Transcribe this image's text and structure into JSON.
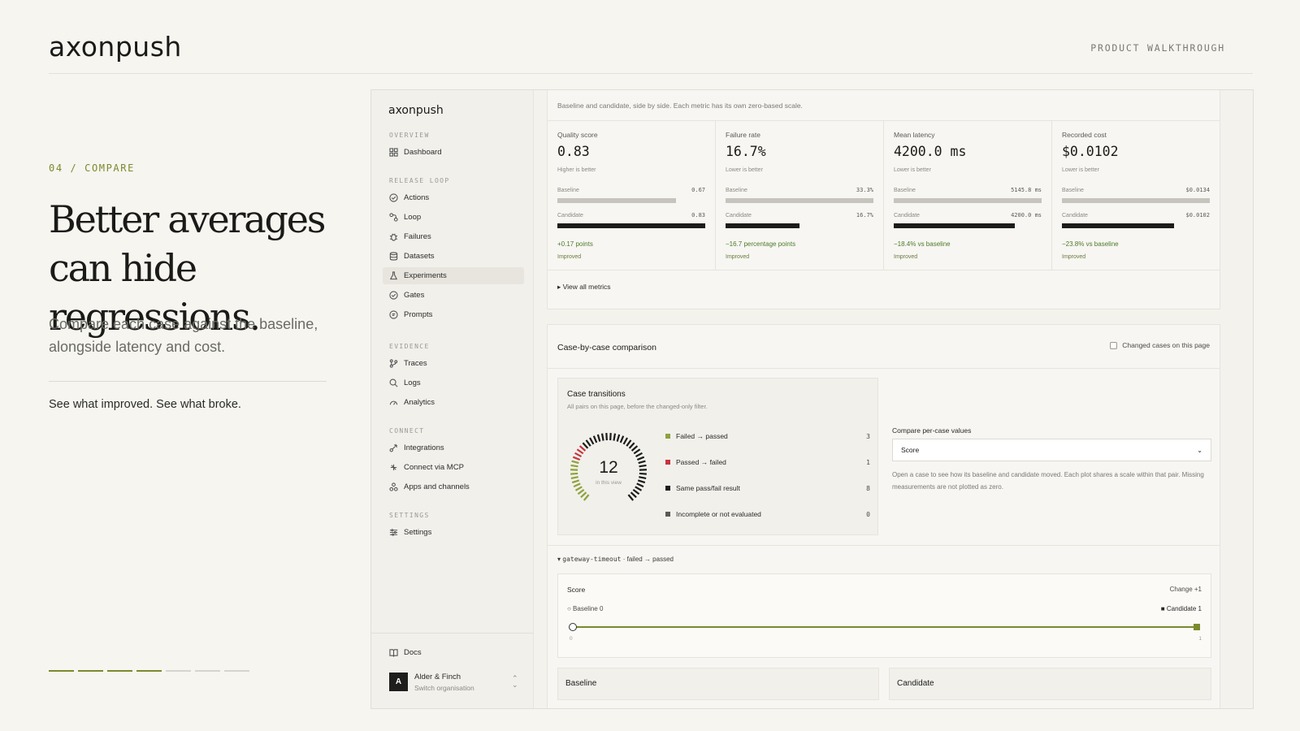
{
  "header": {
    "brand": "axonpush",
    "walkthrough": "PRODUCT WALKTHROUGH"
  },
  "hero": {
    "eyebrow": "04 / COMPARE",
    "headline": "Better averages can hide regressions.",
    "lede": "Compare each case against the baseline, alongside latency and cost.",
    "tagline": "See what improved. See what broke.",
    "progress_total": 7,
    "progress_current": 4
  },
  "sidebar": {
    "logo": "axonpush",
    "sections": {
      "overview": "OVERVIEW",
      "release_loop": "RELEASE LOOP",
      "evidence": "EVIDENCE",
      "connect": "CONNECT",
      "settings": "SETTINGS"
    },
    "items": {
      "dashboard": "Dashboard",
      "actions": "Actions",
      "loop": "Loop",
      "failures": "Failures",
      "datasets": "Datasets",
      "experiments": "Experiments",
      "gates": "Gates",
      "prompts": "Prompts",
      "traces": "Traces",
      "logs": "Logs",
      "analytics": "Analytics",
      "integrations": "Integrations",
      "connect_mcp": "Connect via MCP",
      "apps_channels": "Apps and channels",
      "settings": "Settings",
      "docs": "Docs"
    },
    "active": "experiments",
    "org": {
      "avatar": "A",
      "name": "Alder & Finch",
      "action": "Switch organisation"
    }
  },
  "metrics": {
    "description": "Baseline and candidate, side by side. Each metric has its own zero-based scale.",
    "row_labels": {
      "baseline": "Baseline",
      "candidate": "Candidate"
    },
    "view_all": "View all metrics",
    "cards": [
      {
        "label": "Quality score",
        "value": "0.83",
        "hint": "Higher is better",
        "baseline": "0.67",
        "candidate": "0.83",
        "baseline_frac": 0.8,
        "candidate_frac": 1.0,
        "delta": "+0.17 points",
        "status": "Improved"
      },
      {
        "label": "Failure rate",
        "value": "16.7%",
        "hint": "Lower is better",
        "baseline": "33.3%",
        "candidate": "16.7%",
        "baseline_frac": 1.0,
        "candidate_frac": 0.5,
        "delta": "−16.7 percentage points",
        "status": "Improved"
      },
      {
        "label": "Mean latency",
        "value": "4200.0 ms",
        "hint": "Lower is better",
        "baseline": "5145.8 ms",
        "candidate": "4200.0 ms",
        "baseline_frac": 1.0,
        "candidate_frac": 0.82,
        "delta": "−18.4% vs baseline",
        "status": "Improved"
      },
      {
        "label": "Recorded cost",
        "value": "$0.0102",
        "hint": "Lower is better",
        "baseline": "$0.0134",
        "candidate": "$0.0102",
        "baseline_frac": 1.0,
        "candidate_frac": 0.76,
        "delta": "−23.8% vs baseline",
        "status": "Improved"
      }
    ]
  },
  "comparison": {
    "title": "Case-by-case comparison",
    "changed_only_label": "Changed cases on this page",
    "transitions": {
      "title": "Case transitions",
      "subtitle": "All pairs on this page, before the changed-only filter.",
      "total": "12",
      "total_caption": "in this view",
      "rows": [
        {
          "label": "Failed → passed",
          "count": "3",
          "color": "#8ea23a"
        },
        {
          "label": "Passed → failed",
          "count": "1",
          "color": "#c8343e"
        },
        {
          "label": "Same pass/fail result",
          "count": "8",
          "color": "#1c1c1a"
        },
        {
          "label": "Incomplete or not evaluated",
          "count": "0",
          "color": "#5a5a55"
        }
      ]
    },
    "compare_values": {
      "label": "Compare per-case values",
      "selected": "Score",
      "help": "Open a case to see how its baseline and candidate moved. Each plot shares a scale within that pair. Missing measurements are not plotted as zero."
    },
    "case": {
      "toggle_name": "gateway-timeout",
      "toggle_status": " · failed → passed",
      "score_title": "Score",
      "change": "Change +1",
      "baseline_label": "○ Baseline 0",
      "candidate_label": "■ Candidate 1",
      "tick_min": "0",
      "tick_max": "1"
    },
    "sub_baseline": "Baseline",
    "sub_candidate": "Candidate"
  }
}
